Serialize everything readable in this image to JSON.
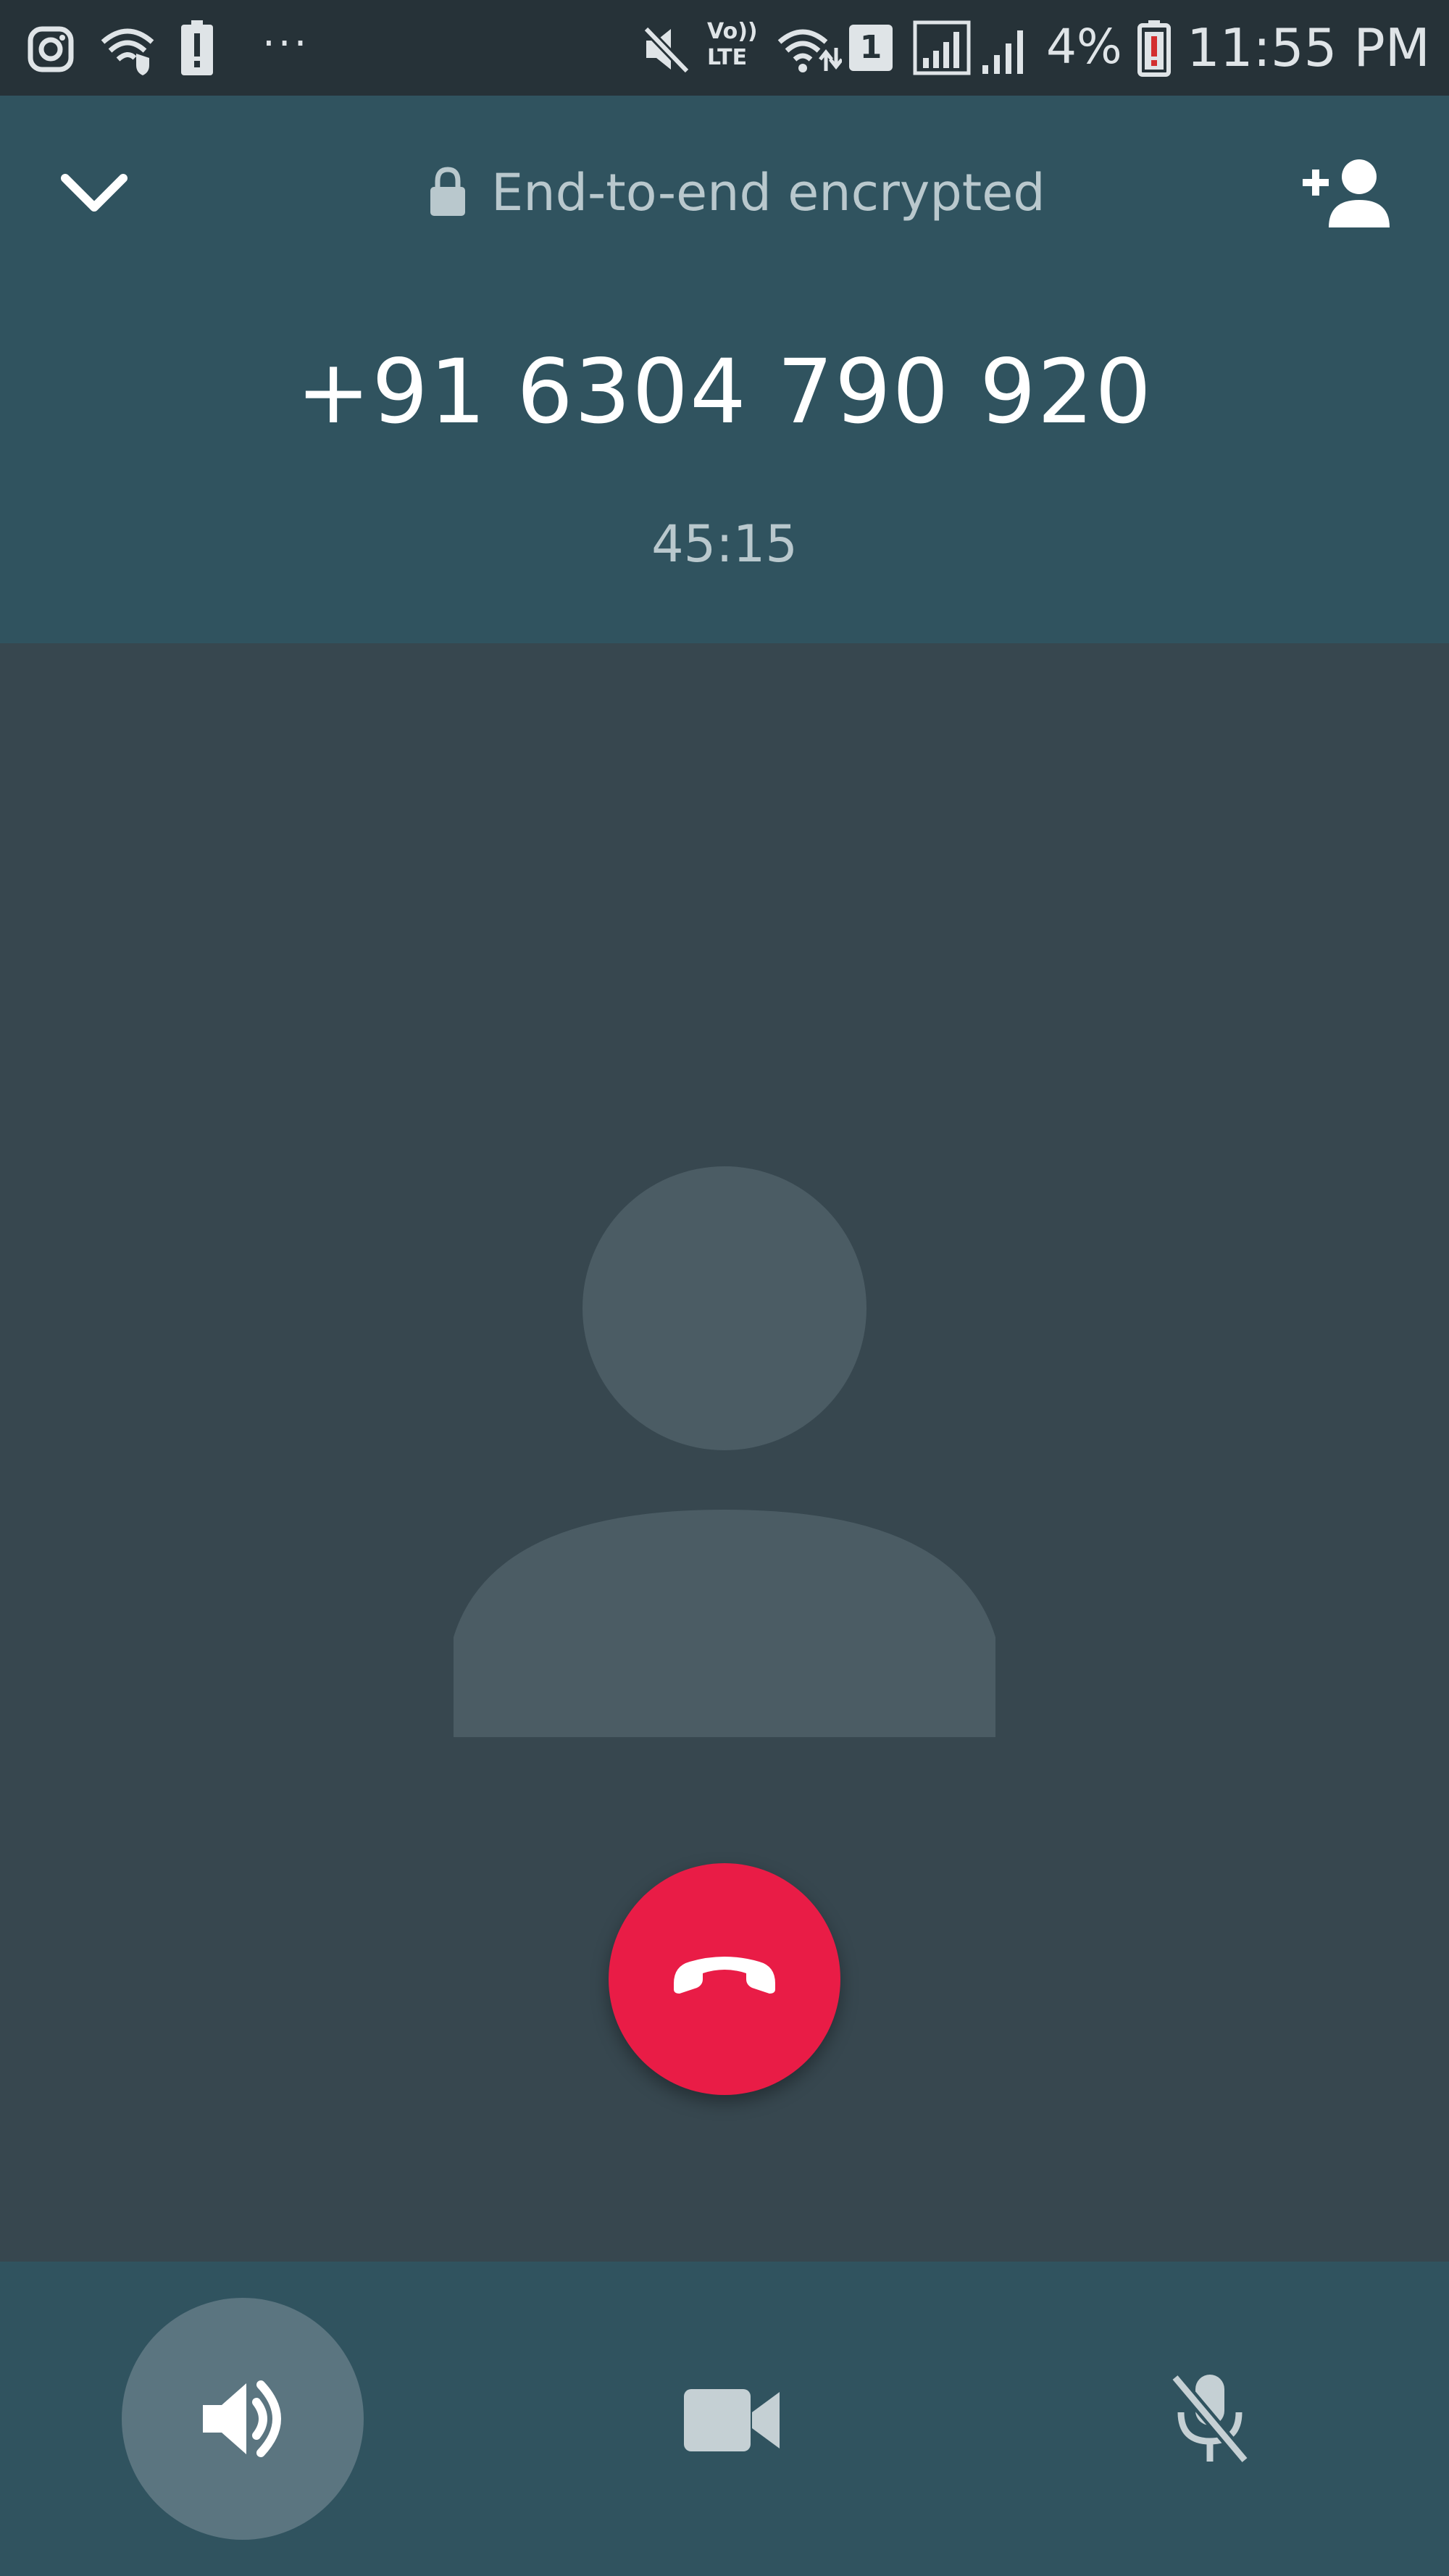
{
  "status_bar": {
    "network_type": "LTE",
    "volte_label": "Vo))",
    "sim_slot": "1",
    "battery_percent": "4%",
    "time": "11:55 PM",
    "more": "···"
  },
  "header": {
    "encryption_label": "End-to-end encrypted",
    "phone_number": "+91 6304 790 920",
    "call_duration": "45:15"
  },
  "colors": {
    "header_bg": "#30535f",
    "main_bg": "#37474f",
    "end_call": "#e91c46",
    "speaker_active": "#5b7580"
  },
  "controls": {
    "speaker": "speaker-icon",
    "video": "video-camera-icon",
    "mute": "microphone-off-icon",
    "speaker_active": true
  }
}
